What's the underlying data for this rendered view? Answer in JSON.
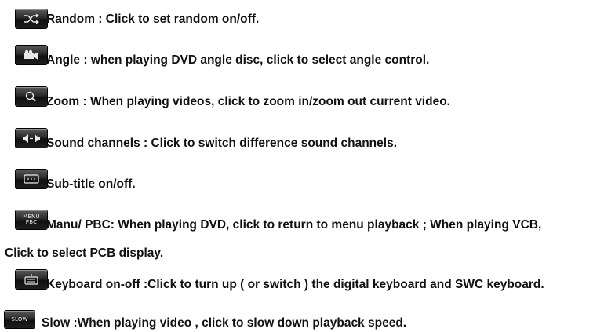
{
  "items": [
    {
      "icon": "shuffle-icon",
      "text": "Random : Click to set random on/off."
    },
    {
      "icon": "camera-angle-icon",
      "text": "Angle : when playing DVD angle disc, click to select angle control."
    },
    {
      "icon": "zoom-magnifier-icon",
      "text": "Zoom : When playing videos, click to zoom in/zoom out current video."
    },
    {
      "icon": "sound-channels-icon",
      "text": "Sound channels : Click to switch difference sound channels."
    },
    {
      "icon": "subtitle-icon",
      "text": "Sub-title on/off."
    },
    {
      "icon": "menu-pbc-icon",
      "icon_text_1": "MENU",
      "icon_text_2": "PBC",
      "text": "Manu/ PBC: When playing DVD, click to return to menu playback ; When playing VCB,",
      "continuation": "Click to select PCB display."
    },
    {
      "icon": "keyboard-icon",
      "text": "Keyboard on-off :Click to turn up ( or switch ) the digital keyboard and SWC keyboard."
    },
    {
      "icon": "slow-icon",
      "icon_text": "SLOW",
      "text": "Slow :When playing video , click to slow down playback speed."
    }
  ]
}
